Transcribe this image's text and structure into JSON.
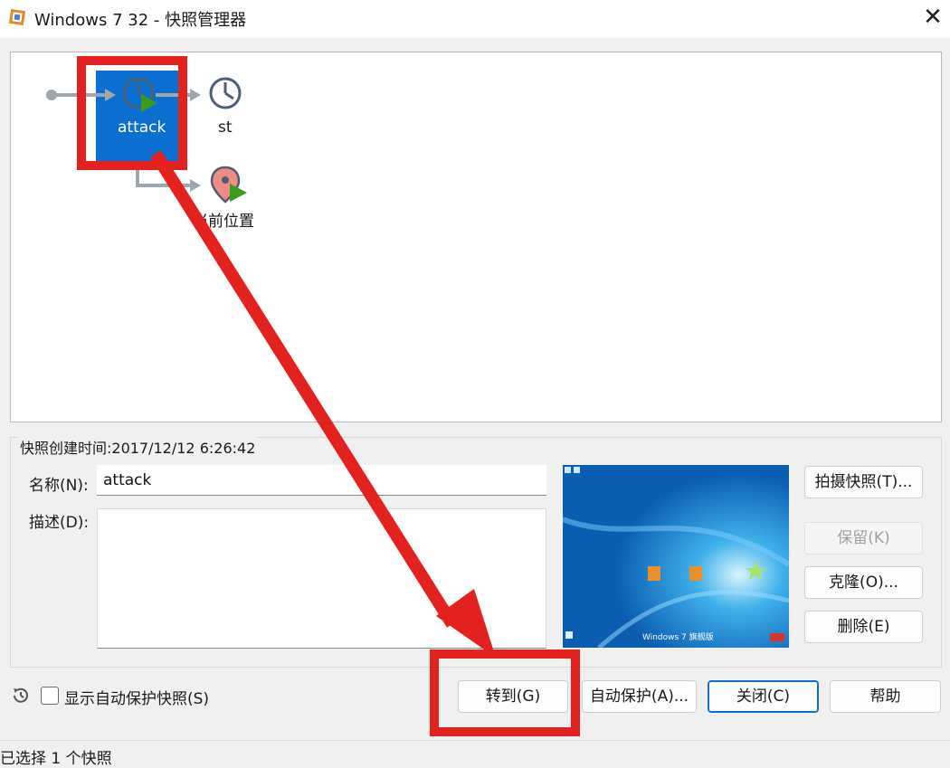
{
  "window": {
    "title": "Windows 7 32 - 快照管理器",
    "icon": "virtualbox-icon",
    "close_symbol": "✕"
  },
  "tree": {
    "nodes": [
      {
        "label": "attack",
        "icon": "snapshot-clock-icon",
        "state": "selected, current base"
      },
      {
        "label": "st",
        "icon": "snapshot-clock-icon"
      },
      {
        "label": "当前位置",
        "icon": "current-state-pin-icon"
      }
    ],
    "selection_color": "#0a6fd1"
  },
  "details": {
    "created_label": "快照创建时间:2017/12/12 6:26:42",
    "name_label": "名称(N):",
    "name_value": "attack",
    "desc_label": "描述(D):",
    "desc_value": "",
    "preview": {
      "taskbar_text": "Windows 7 旗舰版",
      "icon": "windows7-desktop-thumbnail"
    }
  },
  "side_buttons": {
    "take": "拍摄快照(T)...",
    "keep": "保留(K)",
    "clone": "克隆(O)...",
    "delete": "删除(E)"
  },
  "bottom": {
    "show_auto_label": "显示自动保护快照(S)",
    "show_auto_checked": false,
    "goto": "转到(G)",
    "auto_protect": "自动保护(A)...",
    "close": "关闭(C)",
    "help": "帮助"
  },
  "status": {
    "text": "已选择 1 个快照"
  },
  "annotation": {
    "color": "#e3211f",
    "meaning": "red boxes around 'attack' snapshot and 转到(G) button, connected by a red arrow"
  }
}
